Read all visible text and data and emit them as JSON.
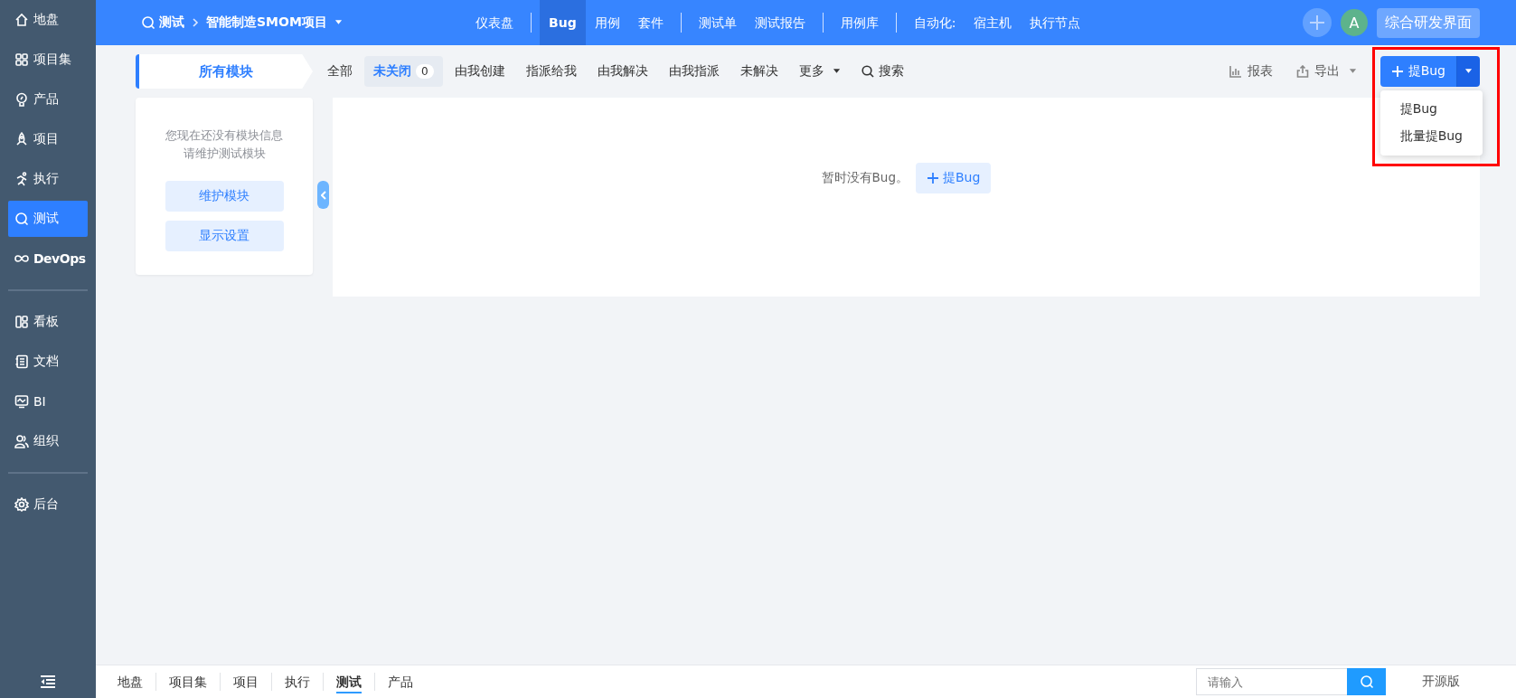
{
  "sidebar": {
    "groups": [
      [
        {
          "label": "地盘",
          "selected": false
        },
        {
          "label": "项目集",
          "selected": false
        },
        {
          "label": "产品",
          "selected": false
        },
        {
          "label": "项目",
          "selected": false
        },
        {
          "label": "执行",
          "selected": false
        },
        {
          "label": "测试",
          "selected": true
        },
        {
          "label": "DevOps",
          "selected": false
        }
      ],
      [
        {
          "label": "看板",
          "selected": false
        },
        {
          "label": "文档",
          "selected": false
        },
        {
          "label": "BI",
          "selected": false
        },
        {
          "label": "组织",
          "selected": false
        }
      ],
      [
        {
          "label": "后台",
          "selected": false
        }
      ]
    ]
  },
  "header": {
    "breadcrumb": [
      "测试",
      "智能制造SMOM项目"
    ],
    "nav_groups": [
      [
        {
          "label": "仪表盘",
          "selected": false
        }
      ],
      [
        {
          "label": "Bug",
          "selected": true
        },
        {
          "label": "用例",
          "selected": false
        },
        {
          "label": "套件",
          "selected": false
        }
      ],
      [
        {
          "label": "测试单",
          "selected": false
        },
        {
          "label": "测试报告",
          "selected": false
        }
      ],
      [
        {
          "label": "用例库",
          "selected": false
        }
      ],
      [
        {
          "label": "自动化:",
          "selected": false
        },
        {
          "label": "宿主机",
          "selected": false
        },
        {
          "label": "执行节点",
          "selected": false
        }
      ]
    ],
    "avatar": "A",
    "workspace_button": "综合研发界面"
  },
  "module_tab": "所有模块",
  "filters": [
    {
      "kind": "tab",
      "label": "全部",
      "selected": false
    },
    {
      "kind": "tab",
      "label": "未关闭",
      "selected": true,
      "count": "0"
    },
    {
      "kind": "tab",
      "label": "由我创建",
      "selected": false
    },
    {
      "kind": "tab",
      "label": "指派给我",
      "selected": false
    },
    {
      "kind": "tab",
      "label": "由我解决",
      "selected": false
    },
    {
      "kind": "tab",
      "label": "由我指派",
      "selected": false
    },
    {
      "kind": "tab",
      "label": "未解决",
      "selected": false
    },
    {
      "kind": "menu",
      "label": "更多",
      "selected": false
    },
    {
      "kind": "search",
      "label": "搜索",
      "selected": false
    }
  ],
  "actions": {
    "report": "报表",
    "export": "导出",
    "create_button": "提Bug",
    "menu": {
      "expanded": true,
      "items": [
        "提Bug",
        "批量提Bug"
      ]
    }
  },
  "module_panel": {
    "message": [
      "您现在还没有模块信息",
      "请维护测试模块"
    ],
    "buttons": [
      "维护模块",
      "显示设置"
    ]
  },
  "empty_state": {
    "message": "暂时没有Bug。",
    "button": "提Bug"
  },
  "bottom_bar": {
    "tabs": [
      {
        "label": "地盘",
        "selected": false
      },
      {
        "label": "项目集",
        "selected": false
      },
      {
        "label": "项目",
        "selected": false
      },
      {
        "label": "执行",
        "selected": false
      },
      {
        "label": "测试",
        "selected": true
      },
      {
        "label": "产品",
        "selected": false
      }
    ],
    "search": {
      "placeholder": "请输入"
    },
    "version": "开源版"
  }
}
